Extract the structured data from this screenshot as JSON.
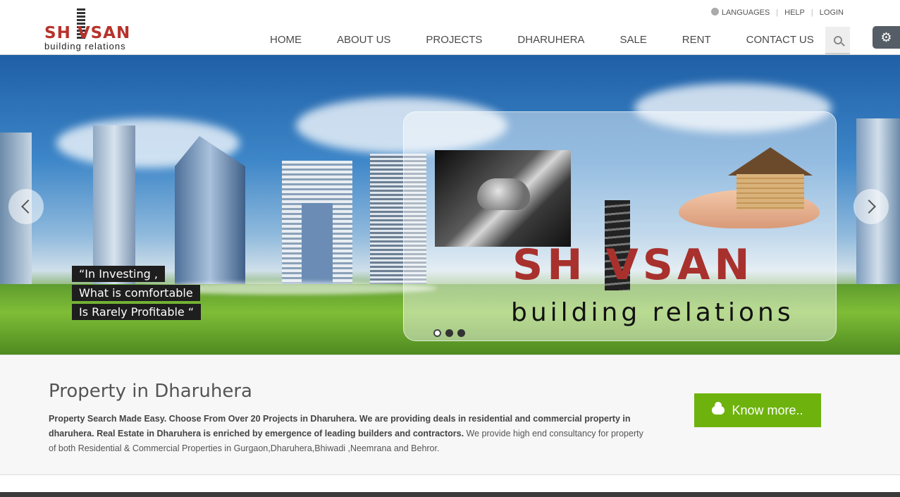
{
  "brand": {
    "logo_text": "SH VSAN",
    "tagline": "building relations"
  },
  "toplinks": [
    "LANGUAGES",
    "HELP",
    "LOGIN"
  ],
  "nav": [
    "HOME",
    "ABOUT US",
    "PROJECTS",
    "DHARUHERA",
    "SALE",
    "RENT",
    "CONTACT US"
  ],
  "icons": {
    "search": "search-icon",
    "settings": "gear-icon",
    "languages": "globe-icon",
    "know_more": "cloud-download-icon"
  },
  "hero": {
    "quote_lines": [
      "“In Investing ,",
      "What is comfortable",
      "Is Rarely Profitable “"
    ],
    "promo_logo": "SH VSAN",
    "promo_tagline": "building relations",
    "slide_count": 3,
    "active_slide": 1
  },
  "content": {
    "title": "Property in Dharuhera",
    "desc_bold": "Property Search Made Easy. Choose From Over 20 Projects in Dharuhera. We are providing deals in residential and commercial property in dharuhera. Real Estate in Dharuhera is enriched by emergence of leading builders and contractors.",
    "desc_normal": " We provide high end consultancy for property of both Residential & Commercial Properties in Gurgaon,Dharuhera,Bhiwadi ,Neemrana and Behror.",
    "button_label": "Know more.."
  },
  "colors": {
    "brand_red": "#b7322c",
    "button_green": "#6eb30d",
    "settings_bg": "#555d66"
  }
}
